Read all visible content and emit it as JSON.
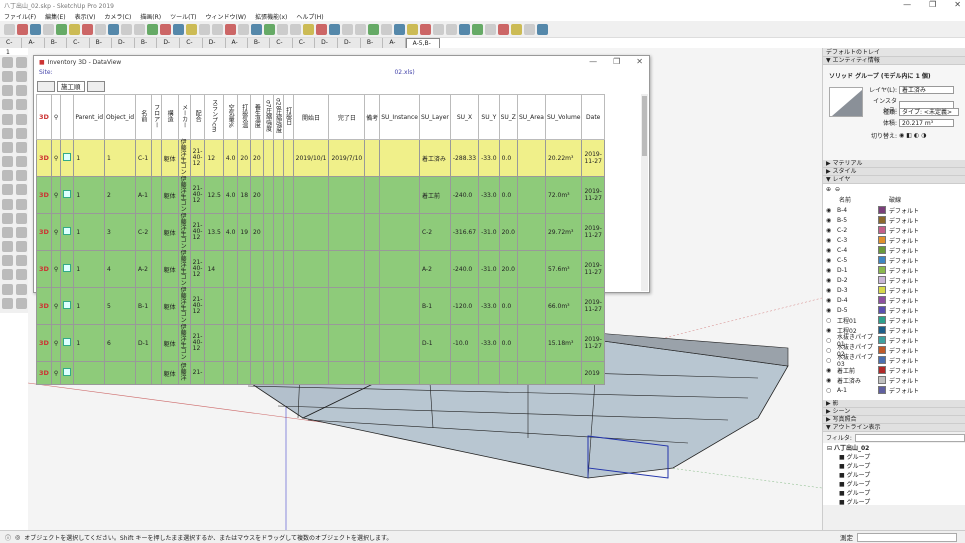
{
  "window": {
    "title": "八丁出山_02.skp - SketchUp Pro 2019",
    "controls": [
      "—",
      "❐",
      "✕"
    ]
  },
  "menu": [
    "ファイル(F)",
    "編集(E)",
    "表示(V)",
    "カメラ(C)",
    "描画(R)",
    "ツール(T)",
    "ウィンドウ(W)",
    "拡張機能(x)",
    "ヘルプ(H)"
  ],
  "scenes": [
    "C-1",
    "A-1",
    "B-2",
    "C-2",
    "B-1",
    "D-1",
    "B-2",
    "D-2",
    "C-3",
    "D-3",
    "A-3",
    "B-3",
    "C-4",
    "C-5",
    "D-4",
    "D-5",
    "B-4",
    "A-4",
    "A-5,B-5"
  ],
  "active_scene": 18,
  "dataview": {
    "title": "Inventory 3D - DataView",
    "site": "Site:",
    "site_path": "02.xls)",
    "tabs": [
      "",
      "施工順",
      ""
    ],
    "headers": [
      "Parent_id",
      "Object_id",
      "名前",
      "フロアー",
      "構造",
      "メーカー",
      "配合",
      "スランプcm",
      "空気量%",
      "打設気温",
      "養生温度",
      "σ7圧縮強度",
      "σ28圧縮強度",
      "打設日",
      "開始日",
      "完了日",
      "備考",
      "SU_Instance",
      "SU_Layer",
      "SU_X",
      "SU_Y",
      "SU_Z",
      "SU_Area",
      "SU_Volume",
      "Date"
    ],
    "rows": [
      [
        "1",
        "1",
        "C-1",
        "",
        "躯体",
        "伊藤洋生コン",
        "21-40-12",
        "12",
        "4.0",
        "20",
        "20",
        "",
        "",
        "",
        "2019/10/1",
        "2019/7/10",
        "",
        "",
        "着工済み",
        "-288.33",
        "-33.0",
        "0.0",
        "",
        "20.22m³",
        "2019-11-27"
      ],
      [
        "1",
        "2",
        "A-1",
        "",
        "躯体",
        "伊藤洋生コン",
        "21-40-12",
        "12.5",
        "4.0",
        "18",
        "20",
        "",
        "",
        "",
        "",
        "",
        "",
        "",
        "着工前",
        "-240.0",
        "-33.0",
        "0.0",
        "",
        "72.0m³",
        "2019-11-27"
      ],
      [
        "1",
        "3",
        "C-2",
        "",
        "躯体",
        "伊藤洋生コン",
        "21-40-12",
        "13.5",
        "4.0",
        "19",
        "20",
        "",
        "",
        "",
        "",
        "",
        "",
        "",
        "C-2",
        "-316.67",
        "-31.0",
        "20.0",
        "",
        "29.72m³",
        "2019-11-27"
      ],
      [
        "1",
        "4",
        "A-2",
        "",
        "躯体",
        "伊藤洋生コン",
        "21-40-12",
        "14",
        "",
        "",
        "",
        "",
        "",
        "",
        "",
        "",
        "",
        "",
        "A-2",
        "-240.0",
        "-31.0",
        "20.0",
        "",
        "57.6m³",
        "2019-11-27"
      ],
      [
        "1",
        "5",
        "B-1",
        "",
        "躯体",
        "伊藤洋生コン",
        "21-40-12",
        "",
        "",
        "",
        "",
        "",
        "",
        "",
        "",
        "",
        "",
        "",
        "B-1",
        "-120.0",
        "-33.0",
        "0.0",
        "",
        "66.0m³",
        "2019-11-27"
      ],
      [
        "1",
        "6",
        "D-1",
        "",
        "躯体",
        "伊藤洋生コン",
        "21-40-12",
        "",
        "",
        "",
        "",
        "",
        "",
        "",
        "",
        "",
        "",
        "",
        "D-1",
        "-10.0",
        "-33.0",
        "0.0",
        "",
        "15.18m³",
        "2019-11-27"
      ]
    ],
    "partial_row": [
      "",
      "",
      "",
      "",
      "躯体",
      "伊藤洋",
      "21-",
      "",
      "",
      "",
      "",
      "",
      "",
      "",
      "",
      "",
      "",
      "",
      "",
      "",
      "",
      "",
      "",
      "",
      "2019"
    ]
  },
  "tray": {
    "title": "デフォルトのトレイ",
    "entity_section": "エンティティ情報",
    "entity_type": "ソリッド グループ (モデル内に 1 個)",
    "layer_label": "レイヤ(L):",
    "layer_value": "着工済み",
    "instance_label": "インスタンス:",
    "type_label": "種類:",
    "type_value": "タイプ: <未定義>",
    "volume_label": "体積:",
    "volume_value": "20.217 m³",
    "toggle_label": "切り替え:",
    "sections": [
      "マテリアル",
      "スタイル",
      "レイヤ"
    ],
    "layer_col_name": "名前",
    "layer_col_style": "破線",
    "layers": [
      {
        "name": "B-4",
        "color": "#7a3f7a",
        "vis": "eye"
      },
      {
        "name": "B-5",
        "color": "#8c6a2e",
        "vis": "eye"
      },
      {
        "name": "C-2",
        "color": "#c35f8a",
        "vis": "eye"
      },
      {
        "name": "C-3",
        "color": "#e0902c",
        "vis": "eye"
      },
      {
        "name": "C-4",
        "color": "#6a9a3a",
        "vis": "eye"
      },
      {
        "name": "C-5",
        "color": "#3f86c3",
        "vis": "eye"
      },
      {
        "name": "D-1",
        "color": "#8ab84e",
        "vis": "eye"
      },
      {
        "name": "D-2",
        "color": "#c9b6d8",
        "vis": "eye"
      },
      {
        "name": "D-3",
        "color": "#d6d84a",
        "vis": "eye"
      },
      {
        "name": "D-4",
        "color": "#8d4fa0",
        "vis": "eye"
      },
      {
        "name": "D-5",
        "color": "#5a4fb0",
        "vis": "eye"
      },
      {
        "name": "工程01",
        "color": "#2ea08d",
        "vis": "o"
      },
      {
        "name": "工程02",
        "color": "#1f5f8a",
        "vis": "eye"
      },
      {
        "name": "水抜きパイプ01",
        "color": "#3fa0a0",
        "vis": "o"
      },
      {
        "name": "水抜きパイプ02",
        "color": "#c05a2a",
        "vis": "o"
      },
      {
        "name": "水抜きパイプ03",
        "color": "#4a6fb0",
        "vis": "o"
      },
      {
        "name": "着工前",
        "color": "#b02a2a",
        "vis": "eye"
      },
      {
        "name": "着工済み",
        "color": "#c0c0c0",
        "vis": "eye"
      },
      {
        "name": "A-1",
        "color": "#6060a0",
        "vis": "o"
      }
    ],
    "default_style": "デフォルト",
    "lower_sections": [
      "影",
      "シーン",
      "写真照合",
      "アウトライン表示"
    ],
    "filter_label": "フィルタ:",
    "outliner_root": "八丁出山_02",
    "outliner_items": [
      "グループ",
      "グループ",
      "グループ",
      "グループ",
      "グループ",
      "グループ"
    ]
  },
  "status": {
    "text": "オブジェクトを選択してください。Shift キーを押したまま選択するか、またはマウスをドラッグして複数のオブジェクトを選択します。",
    "measure_label": "測定"
  }
}
